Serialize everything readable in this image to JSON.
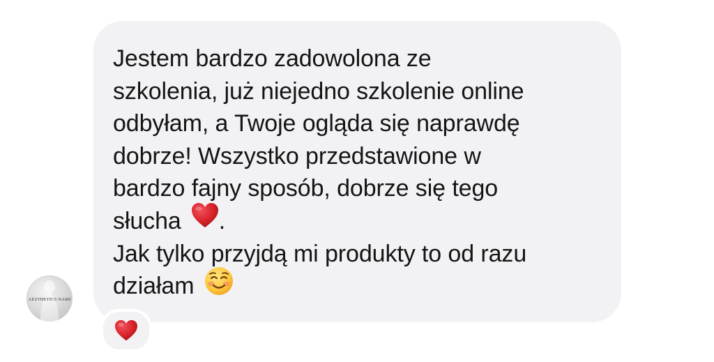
{
  "message": {
    "lines": [
      "Jestem bardzo zadowolona ze",
      "szkolenia, już niejedno szkolenie online",
      "odbyłam, a Twoje ogląda się naprawdę",
      "dobrze! Wszystko przedstawione w",
      "bardzo fajny sposób, dobrze się tego",
      "słucha",
      "Jak tylko przyjdą mi produkty to od razu",
      "działam"
    ],
    "line6_suffix": ".",
    "inline_emojis": [
      "red-heart-emoji",
      "smiling-face-emoji"
    ]
  },
  "avatar": {
    "label": "AESTHETICS NAMI"
  },
  "reaction": {
    "emoji": "red-heart-emoji"
  },
  "colors": {
    "bubble": "#f2f2f5",
    "text": "#141414",
    "heart": "#d9232b"
  }
}
